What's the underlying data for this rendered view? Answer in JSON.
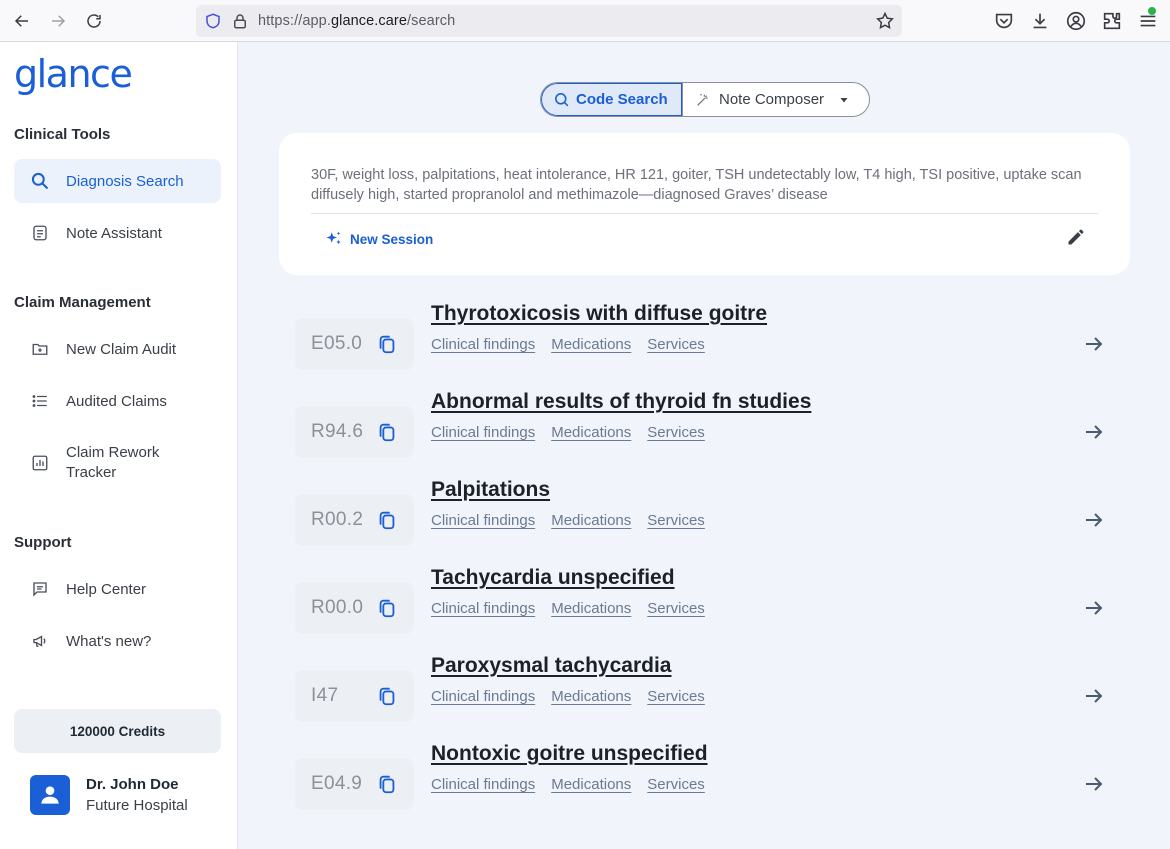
{
  "browser": {
    "url_prefix": "https://app.",
    "url_domain": "glance.care",
    "url_path": "/search"
  },
  "sidebar": {
    "logo": "glance",
    "sections": {
      "clinical_tools": "Clinical Tools",
      "claim_management": "Claim Management",
      "support": "Support"
    },
    "items": {
      "diagnosis_search": "Diagnosis Search",
      "note_assistant": "Note Assistant",
      "new_claim_audit": "New Claim Audit",
      "audited_claims": "Audited Claims",
      "claim_rework_1": "Claim Rework",
      "claim_rework_2": "Tracker",
      "help_center": "Help Center",
      "whats_new": "What's new?"
    },
    "credits": "120000 Credits",
    "user": {
      "name": "Dr. John Doe",
      "org": "Future Hospital"
    }
  },
  "mode": {
    "code_search": "Code Search",
    "note_composer": "Note Composer"
  },
  "query": {
    "text": "30F, weight loss, palpitations, heat intolerance, HR 121, goiter, TSH undetectably low, T4 high, TSI positive, uptake scan diffusely high, started propranolol and methimazole—diagnosed Graves’ disease",
    "new_session": "New Session"
  },
  "link_labels": {
    "findings": "Clinical findings",
    "medications": "Medications",
    "services": "Services"
  },
  "results": [
    {
      "code": "E05.0",
      "title": "Thyrotoxicosis with diffuse goitre"
    },
    {
      "code": "R94.6",
      "title": "Abnormal results of thyroid fn studies"
    },
    {
      "code": "R00.2",
      "title": "Palpitations"
    },
    {
      "code": "R00.0",
      "title": "Tachycardia unspecified"
    },
    {
      "code": "I47",
      "title": "Paroxysmal tachycardia"
    },
    {
      "code": "E04.9",
      "title": "Nontoxic goitre unspecified"
    }
  ],
  "colors": {
    "accent": "#1a5fd6",
    "background": "#f1f4fa"
  }
}
